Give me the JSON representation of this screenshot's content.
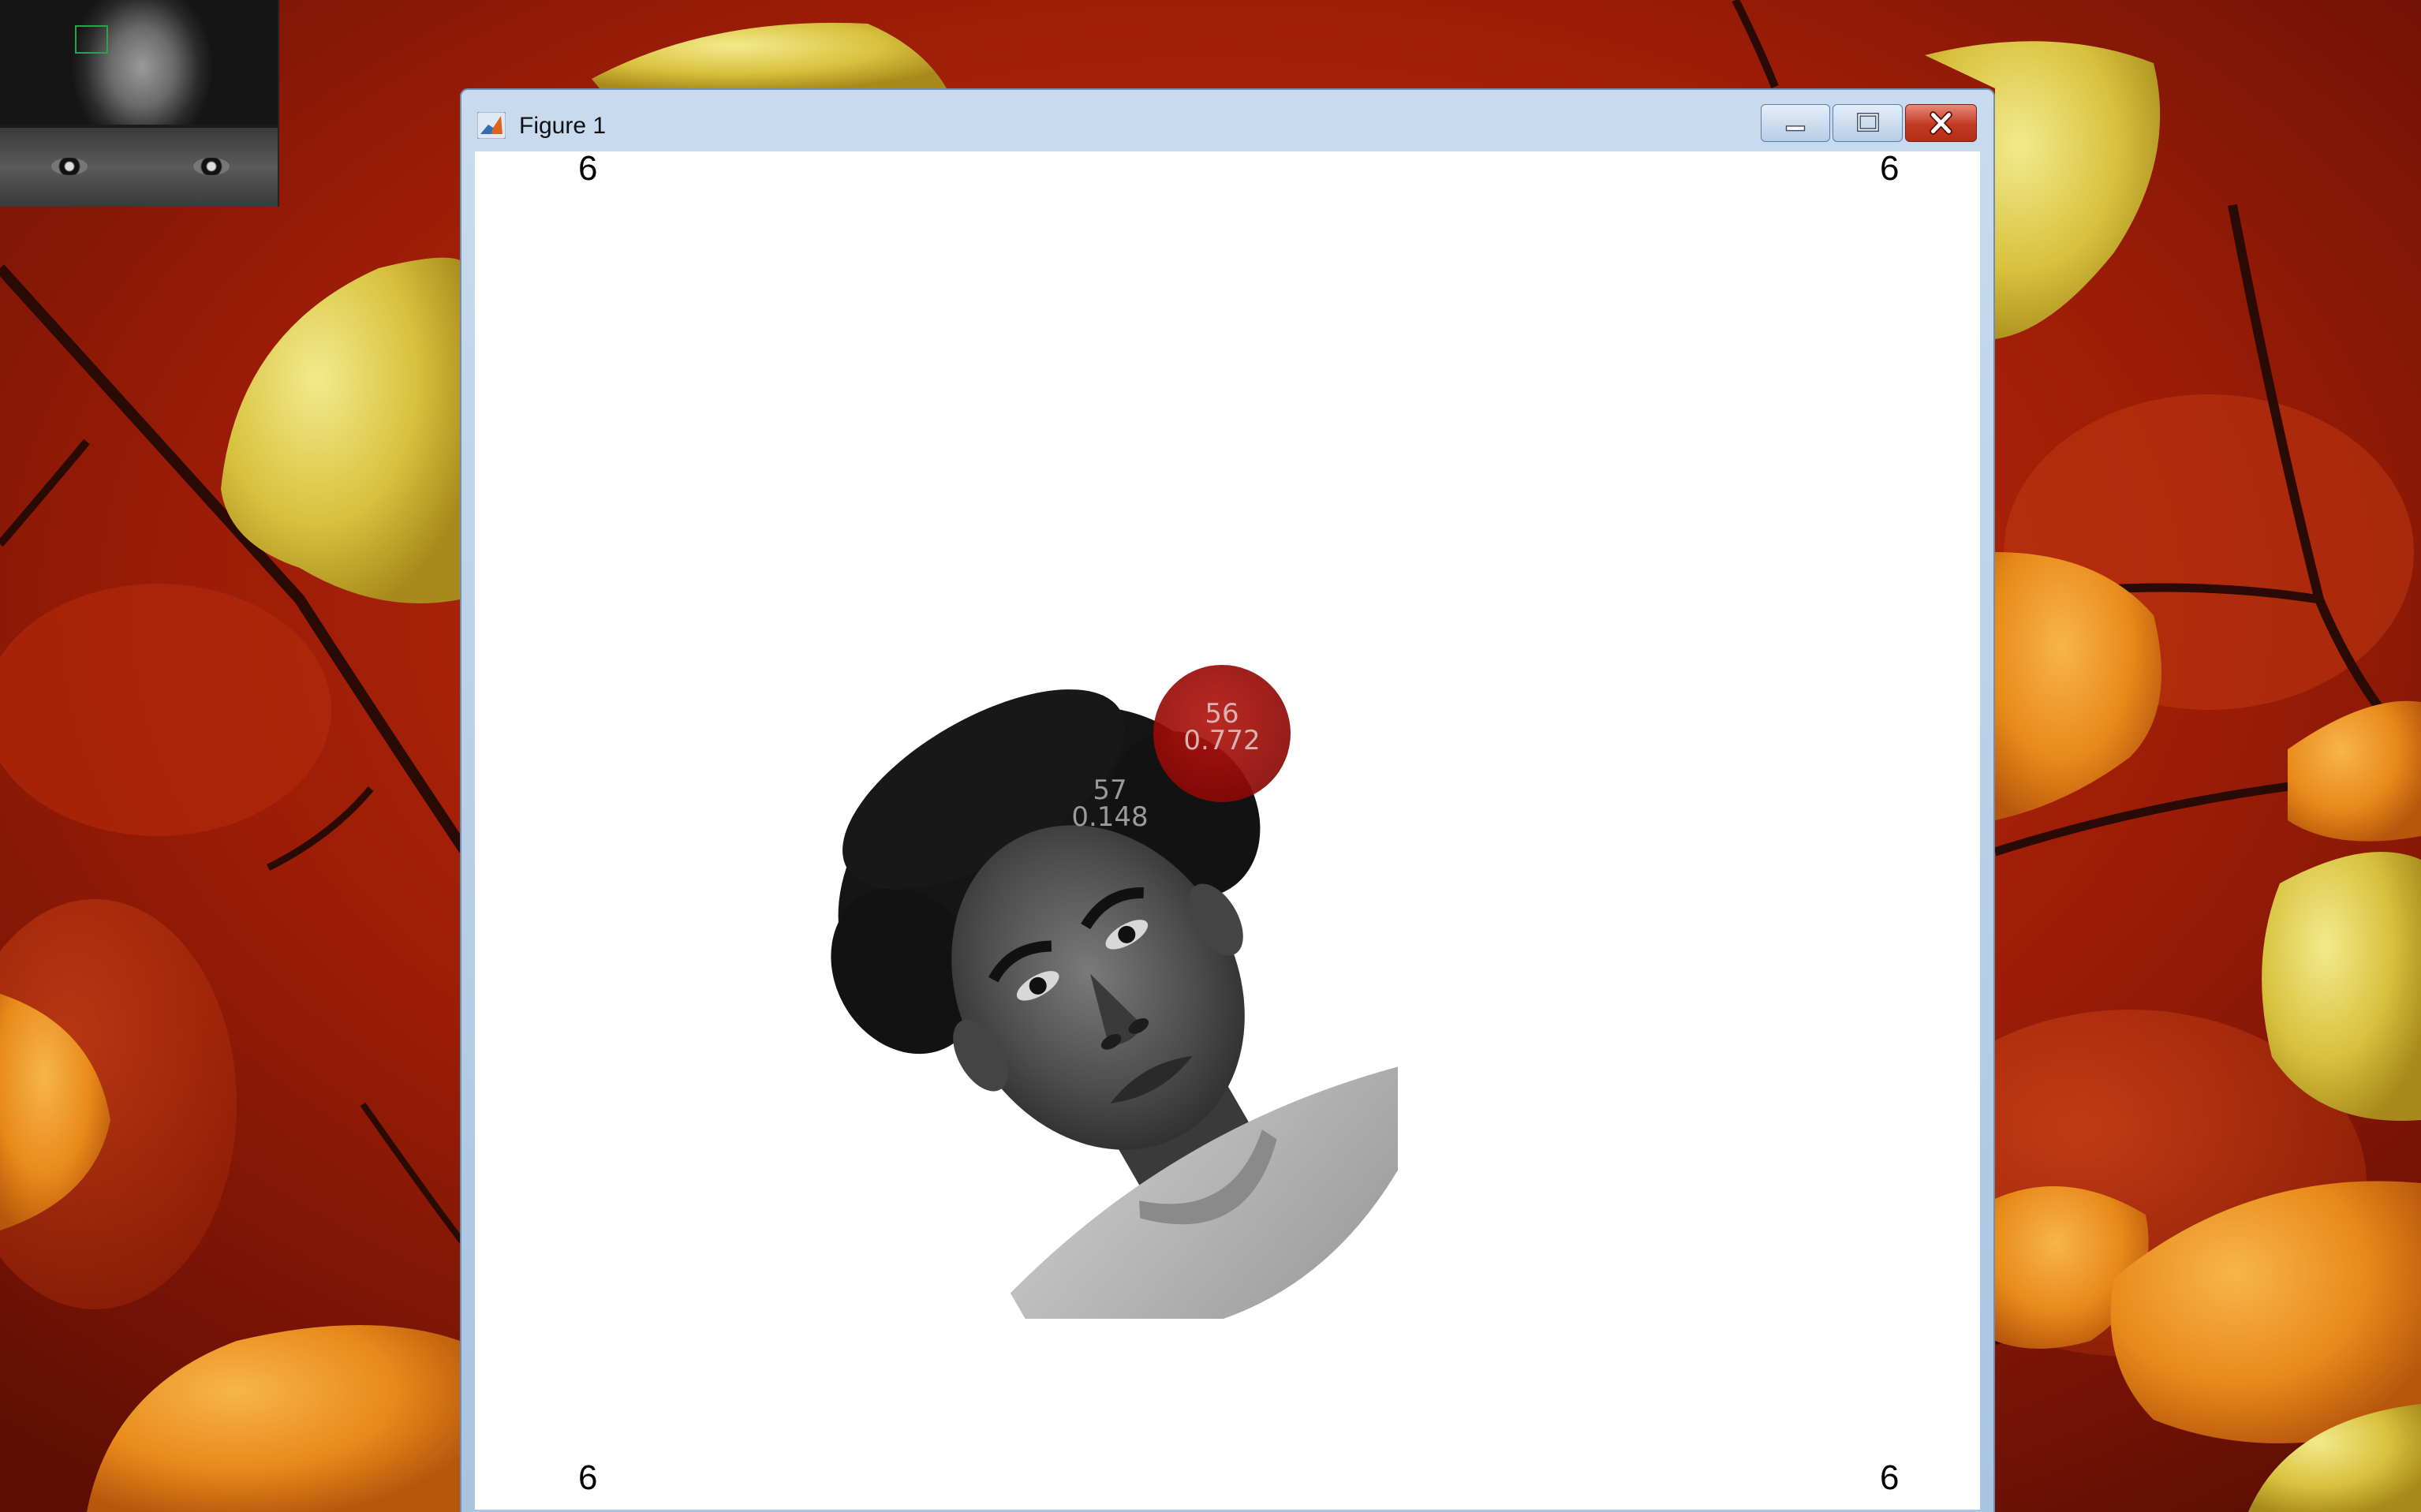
{
  "desktop": {
    "wallpaper_icon": "autumn-leaves-wallpaper"
  },
  "webcam_preview": {
    "icon": "webcam-eye-tracker-preview"
  },
  "window": {
    "title": "Figure 1",
    "app_icon": "matlab-icon",
    "buttons": {
      "minimize_icon": "minimize-icon",
      "maximize_icon": "maximize-icon",
      "close_icon": "close-icon"
    }
  },
  "figure": {
    "corner_labels": {
      "top_left": "6",
      "top_right": "6",
      "bottom_left": "6",
      "bottom_right": "6"
    },
    "stimulus": "grayscale-face-photo",
    "gaze_points": [
      {
        "id": "56",
        "value": "0.772",
        "highlighted": true
      },
      {
        "id": "57",
        "value": "0.148",
        "highlighted": false
      }
    ],
    "marker_color": "#a00d08"
  }
}
